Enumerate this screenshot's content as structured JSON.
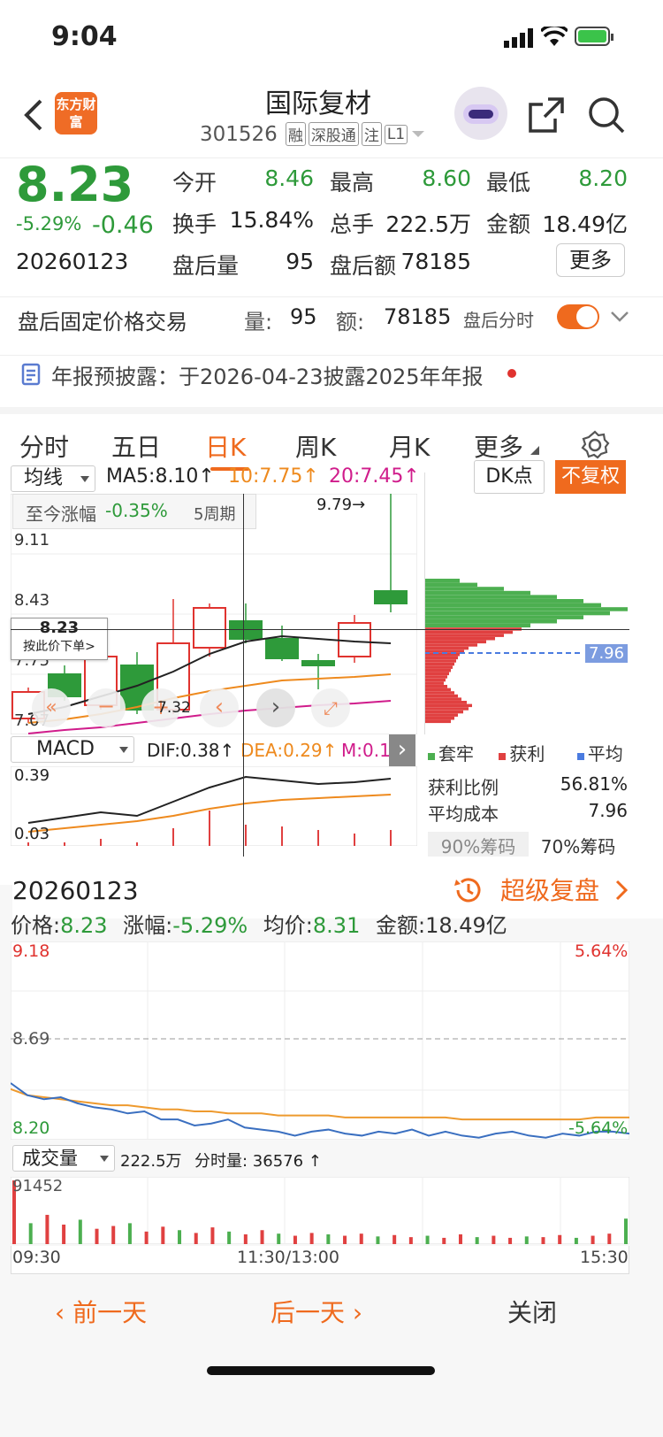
{
  "status": {
    "time": "9:04"
  },
  "header": {
    "title": "国际复材",
    "code": "301526",
    "badges": [
      "融",
      "深股通",
      "注",
      "L1"
    ],
    "logo_text": "东方财富"
  },
  "quote": {
    "price": "8.23",
    "change_pct": "-5.29%",
    "change": "-0.46",
    "date": "20260123",
    "open_label": "今开",
    "open": "8.46",
    "high_label": "最高",
    "high": "8.60",
    "low_label": "最低",
    "low": "8.20",
    "turnover_label": "换手",
    "turnover": "15.84%",
    "volume_label": "总手",
    "volume": "222.5万",
    "amount_label": "金额",
    "amount": "18.49亿",
    "after_vol_label": "盘后量",
    "after_vol": "95",
    "after_amt_label": "盘后额",
    "after_amt": "78185",
    "more": "更多"
  },
  "fixed_trade": {
    "title": "盘后固定价格交易",
    "vol_label": "量:",
    "vol": "95",
    "amt_label": "额:",
    "amt": "78185",
    "toggle_label": "盘后分时",
    "toggle_on": true
  },
  "notice": {
    "text": "年报预披露：于2026-04-23披露2025年年报"
  },
  "tabs": [
    {
      "label": "分时",
      "active": false
    },
    {
      "label": "五日",
      "active": false
    },
    {
      "label": "日K",
      "active": true
    },
    {
      "label": "周K",
      "active": false
    },
    {
      "label": "月K",
      "active": false
    },
    {
      "label": "更多",
      "active": false
    }
  ],
  "kline": {
    "ma_select": "均线",
    "ma5": "MA5:8.10↑",
    "ma10": "10:7.75↑",
    "ma20": "20:7.45↑",
    "dk": "DK点",
    "adjust": "不复权",
    "range_label": "至今涨幅",
    "range_value": "-0.35%",
    "range_period": "5周期",
    "axis": [
      "9.79",
      "9.11",
      "8.43",
      "7.75",
      "7.07"
    ],
    "peak_label": "9.79→",
    "low_mark": "7.32",
    "cross_price": "8.23",
    "cross_hint": "按此价下单>",
    "chips_avg": "7.96"
  },
  "macd": {
    "select": "MACD",
    "dif": "DIF:0.38↑",
    "dea": "DEA:0.29↑",
    "m": "M:0.18↑",
    "axis_top": "0.39",
    "axis_bottom": "0.03"
  },
  "chips": {
    "legend": [
      "套牢",
      "获利",
      "平均"
    ],
    "profit_label": "获利比例",
    "profit_value": "56.81%",
    "cost_label": "平均成本",
    "cost_value": "7.96",
    "tab90": "90%筹码",
    "tab70": "70%筹码"
  },
  "review": {
    "date": "20260123",
    "super_label": "超级复盘",
    "price_label": "价格:",
    "price": "8.23",
    "chg_label": "涨幅:",
    "chg": "-5.29%",
    "avg_label": "均价:",
    "avg": "8.31",
    "amt_label": "金额:",
    "amt": "18.49亿",
    "y_top": "9.18",
    "y_mid": "8.69",
    "y_bot": "8.20",
    "pct_top": "5.64%",
    "pct_bot": "-5.64%",
    "vol_select": "成交量",
    "vol_total": "222.5万",
    "vol_time": "分时量: 36576 ↑",
    "vol_axis": "91452",
    "time_start": "09:30",
    "time_mid": "11:30/13:00",
    "time_end": "15:30"
  },
  "footer": {
    "prev": "前一天",
    "next": "后一天",
    "close": "关闭"
  },
  "colors": {
    "up": "#e0332f",
    "down": "#2e9a3a",
    "accent": "#ee6a1e"
  },
  "candles": [
    {
      "o": 7.25,
      "c": 7.55,
      "h": 7.6,
      "l": 7.2
    },
    {
      "o": 7.75,
      "c": 7.5,
      "h": 7.85,
      "l": 7.45
    },
    {
      "o": 7.4,
      "c": 7.95,
      "h": 8.05,
      "l": 7.35
    },
    {
      "o": 7.85,
      "c": 7.35,
      "h": 8.0,
      "l": 7.3
    },
    {
      "o": 7.35,
      "c": 8.1,
      "h": 8.6,
      "l": 7.3
    },
    {
      "o": 8.05,
      "c": 8.5,
      "h": 8.55,
      "l": 7.95
    },
    {
      "o": 8.35,
      "c": 8.15,
      "h": 8.55,
      "l": 8.1
    },
    {
      "o": 8.15,
      "c": 7.93,
      "h": 8.3,
      "l": 7.9
    },
    {
      "o": 7.9,
      "c": 7.85,
      "h": 7.98,
      "l": 7.58
    },
    {
      "o": 7.95,
      "c": 8.33,
      "h": 8.42,
      "l": 7.88
    },
    {
      "o": 8.69,
      "c": 8.55,
      "h": 9.79,
      "l": 8.45
    }
  ],
  "ma5_vals": [
    7.3,
    7.38,
    7.5,
    7.62,
    7.78,
    7.98,
    8.12,
    8.18,
    8.15,
    8.12,
    8.1
  ],
  "ma10_vals": [
    7.2,
    7.24,
    7.3,
    7.38,
    7.48,
    7.56,
    7.62,
    7.68,
    7.7,
    7.72,
    7.75
  ],
  "ma20_vals": [
    7.08,
    7.12,
    7.15,
    7.2,
    7.25,
    7.3,
    7.34,
    7.37,
    7.4,
    7.42,
    7.45
  ],
  "dif_vals": [
    0.13,
    0.16,
    0.19,
    0.17,
    0.25,
    0.33,
    0.39,
    0.37,
    0.35,
    0.36,
    0.38
  ],
  "dea_vals": [
    0.08,
    0.1,
    0.12,
    0.14,
    0.17,
    0.21,
    0.24,
    0.26,
    0.27,
    0.28,
    0.29
  ],
  "macd_hist": [
    0.02,
    0.02,
    0.04,
    0.02,
    0.1,
    0.2,
    0.12,
    0.11,
    0.09,
    0.07,
    0.09
  ],
  "price_line": [
    8.48,
    8.42,
    8.4,
    8.41,
    8.38,
    8.36,
    8.35,
    8.33,
    8.34,
    8.3,
    8.3,
    8.27,
    8.28,
    8.3,
    8.26,
    8.25,
    8.24,
    8.22,
    8.24,
    8.25,
    8.23,
    8.22,
    8.24,
    8.23,
    8.25,
    8.22,
    8.24,
    8.22,
    8.21,
    8.23,
    8.24,
    8.22,
    8.21,
    8.23,
    8.22,
    8.24,
    8.24,
    8.23
  ],
  "avg_line": [
    8.45,
    8.42,
    8.41,
    8.4,
    8.39,
    8.38,
    8.37,
    8.37,
    8.36,
    8.35,
    8.35,
    8.34,
    8.34,
    8.33,
    8.33,
    8.33,
    8.32,
    8.32,
    8.32,
    8.32,
    8.31,
    8.31,
    8.31,
    8.31,
    8.31,
    8.31,
    8.31,
    8.3,
    8.3,
    8.3,
    8.3,
    8.3,
    8.3,
    8.3,
    8.3,
    8.31,
    8.31,
    8.31
  ],
  "vol_bars": [
    91452,
    30000,
    42000,
    28000,
    35000,
    22000,
    26000,
    30000,
    18000,
    25000,
    20000,
    16000,
    24000,
    18000,
    14000,
    20000,
    15000,
    12000,
    16000,
    14000,
    12000,
    15000,
    11000,
    13000,
    10000,
    12000,
    9000,
    14000,
    10000,
    12000,
    9000,
    11000,
    10000,
    13000,
    9000,
    12000,
    15000,
    36576
  ]
}
